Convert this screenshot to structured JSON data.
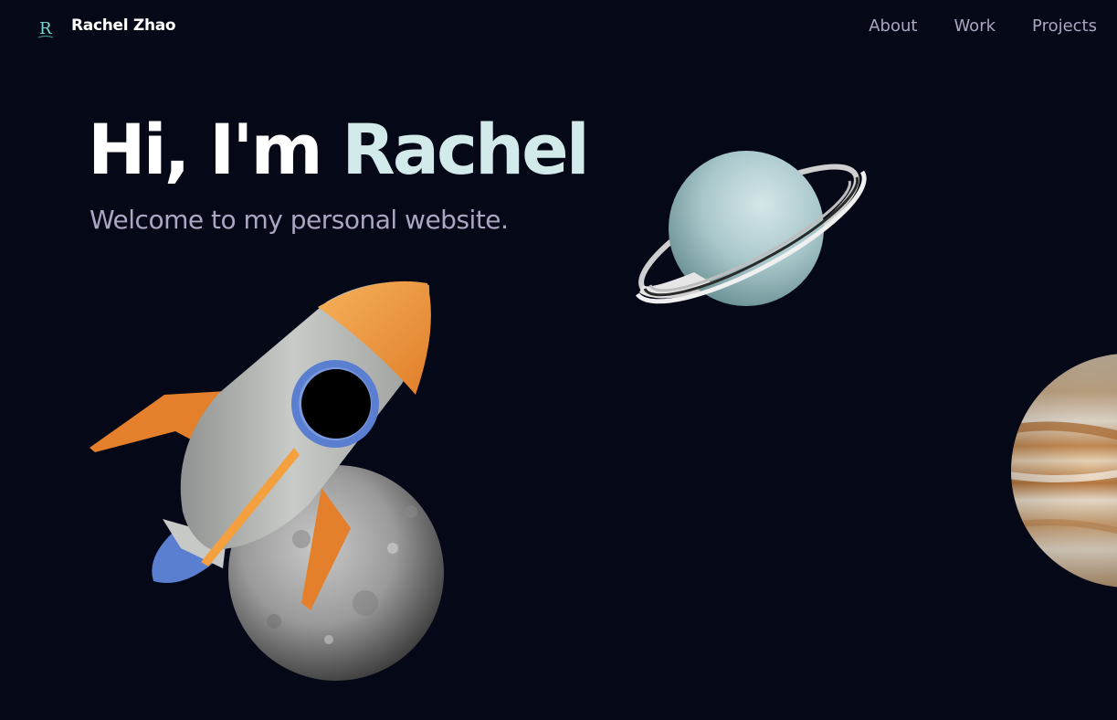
{
  "nav": {
    "brand_name": "Rachel Zhao",
    "logo_letter": "R",
    "links": [
      {
        "label": "About"
      },
      {
        "label": "Work"
      },
      {
        "label": "Projects"
      }
    ]
  },
  "hero": {
    "title_prefix": "Hi, I'm",
    "title_name": "Rachel",
    "subtitle": "Welcome to my personal website."
  },
  "colors": {
    "background": "#050816",
    "accent": "#d2ebea",
    "secondary_text": "#aaa6c3"
  },
  "scene": {
    "objects": [
      "rocket-model",
      "moon-model",
      "ringed-planet-model",
      "gas-giant-model"
    ]
  }
}
